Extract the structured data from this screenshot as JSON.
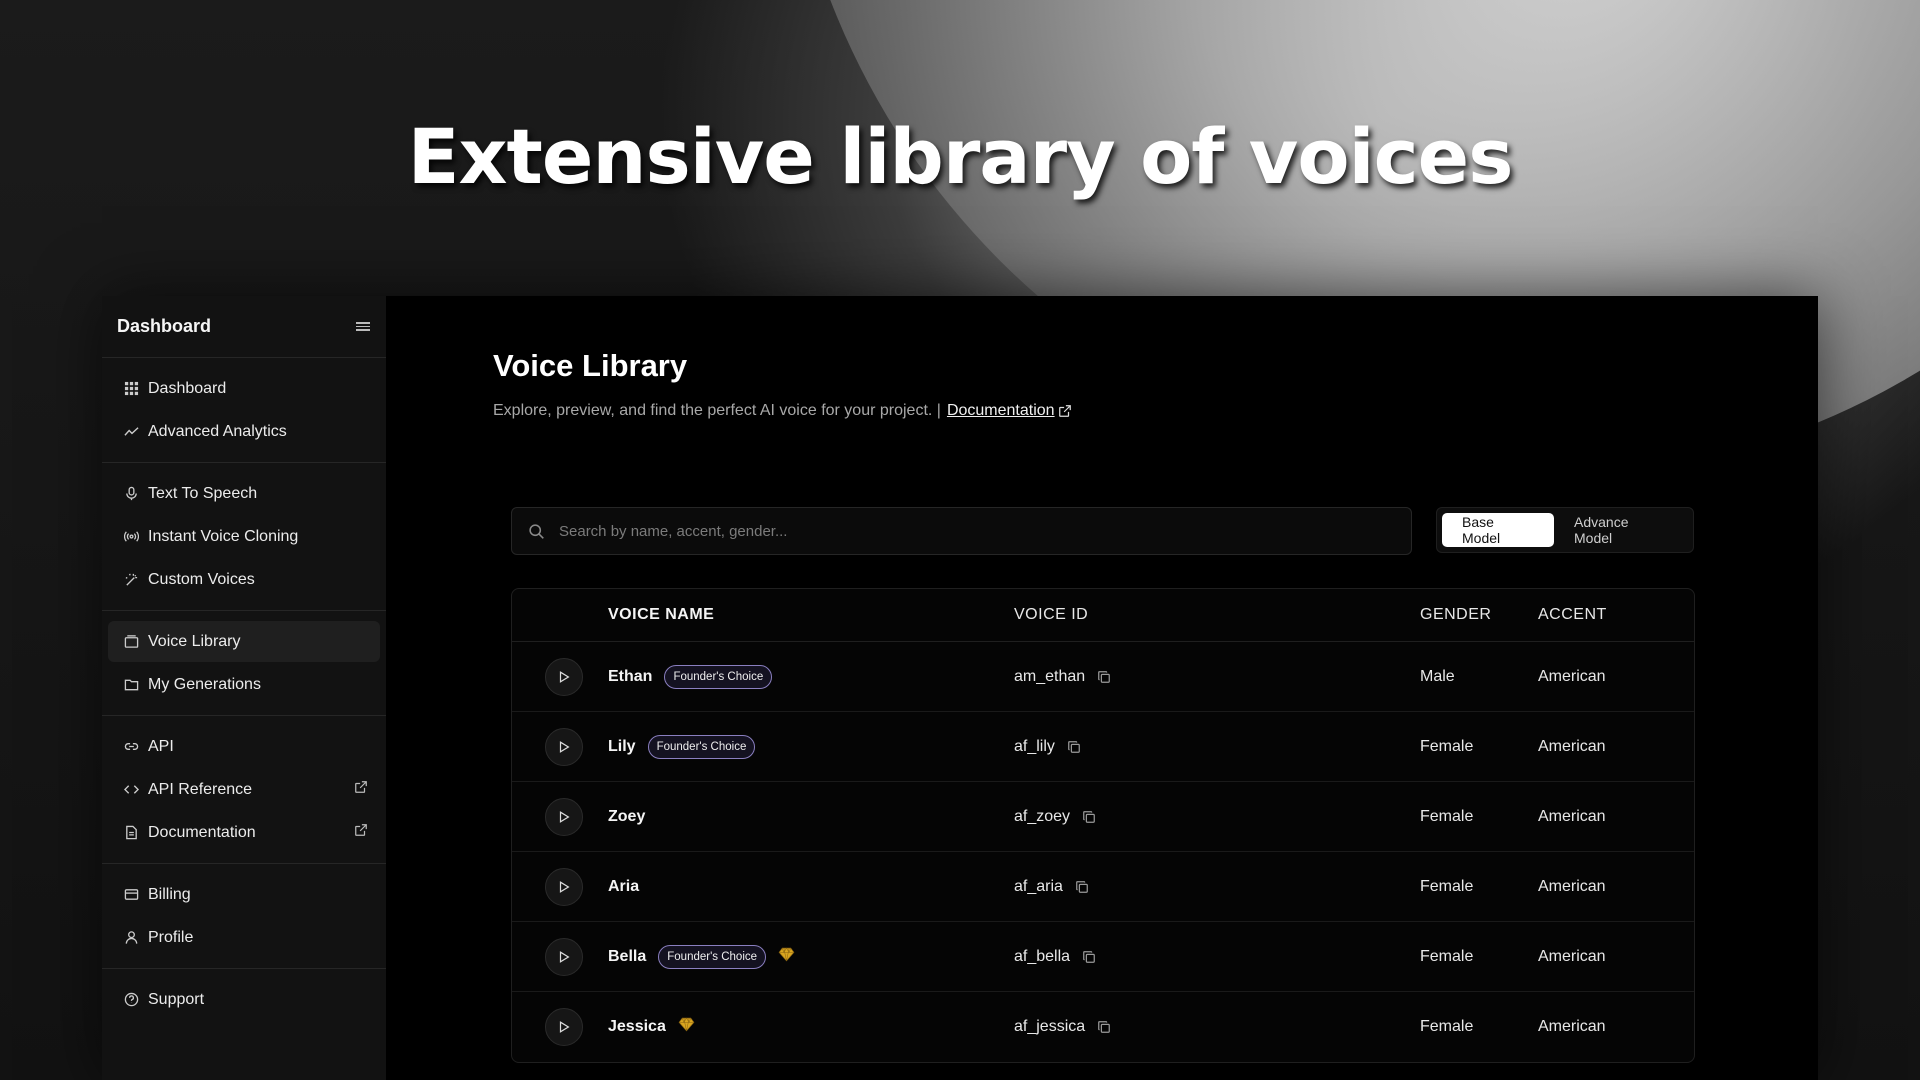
{
  "headline": "Extensive library of voices",
  "sidebar": {
    "title": "Dashboard",
    "groups": [
      [
        {
          "label": "Dashboard",
          "icon": "grid-icon"
        },
        {
          "label": "Advanced Analytics",
          "icon": "trend-icon"
        }
      ],
      [
        {
          "label": "Text To Speech",
          "icon": "mic-icon"
        },
        {
          "label": "Instant Voice Cloning",
          "icon": "broadcast-icon"
        },
        {
          "label": "Custom Voices",
          "icon": "wand-icon"
        }
      ],
      [
        {
          "label": "Voice Library",
          "icon": "library-icon",
          "active": true
        },
        {
          "label": "My Generations",
          "icon": "folder-icon"
        }
      ],
      [
        {
          "label": "API",
          "icon": "link-icon"
        },
        {
          "label": "API Reference",
          "icon": "code-icon",
          "external": true
        },
        {
          "label": "Documentation",
          "icon": "document-icon",
          "external": true
        }
      ],
      [
        {
          "label": "Billing",
          "icon": "card-icon"
        },
        {
          "label": "Profile",
          "icon": "user-icon"
        }
      ],
      [
        {
          "label": "Support",
          "icon": "help-icon"
        }
      ]
    ]
  },
  "main": {
    "title": "Voice Library",
    "subtitle": "Explore, preview, and find the perfect AI voice for your project. |",
    "doc_link": "Documentation",
    "search_placeholder": "Search by name, accent, gender...",
    "model_options": [
      "Base Model",
      "Advance Model"
    ],
    "selected_model": "Base Model",
    "columns": [
      "VOICE NAME",
      "VOICE ID",
      "GENDER",
      "ACCENT"
    ],
    "rows": [
      {
        "name": "Ethan",
        "badge": "Founder's Choice",
        "premium": false,
        "id": "am_ethan",
        "gender": "Male",
        "accent": "American"
      },
      {
        "name": "Lily",
        "badge": "Founder's Choice",
        "premium": false,
        "id": "af_lily",
        "gender": "Female",
        "accent": "American"
      },
      {
        "name": "Zoey",
        "badge": "",
        "premium": false,
        "id": "af_zoey",
        "gender": "Female",
        "accent": "American"
      },
      {
        "name": "Aria",
        "badge": "",
        "premium": false,
        "id": "af_aria",
        "gender": "Female",
        "accent": "American"
      },
      {
        "name": "Bella",
        "badge": "Founder's Choice",
        "premium": true,
        "id": "af_bella",
        "gender": "Female",
        "accent": "American"
      },
      {
        "name": "Jessica",
        "badge": "",
        "premium": true,
        "id": "af_jessica",
        "gender": "Female",
        "accent": "American"
      }
    ]
  },
  "colors": {
    "badge_border": "#8a7fc0",
    "gem": "#d9a520",
    "background": "#000000"
  }
}
